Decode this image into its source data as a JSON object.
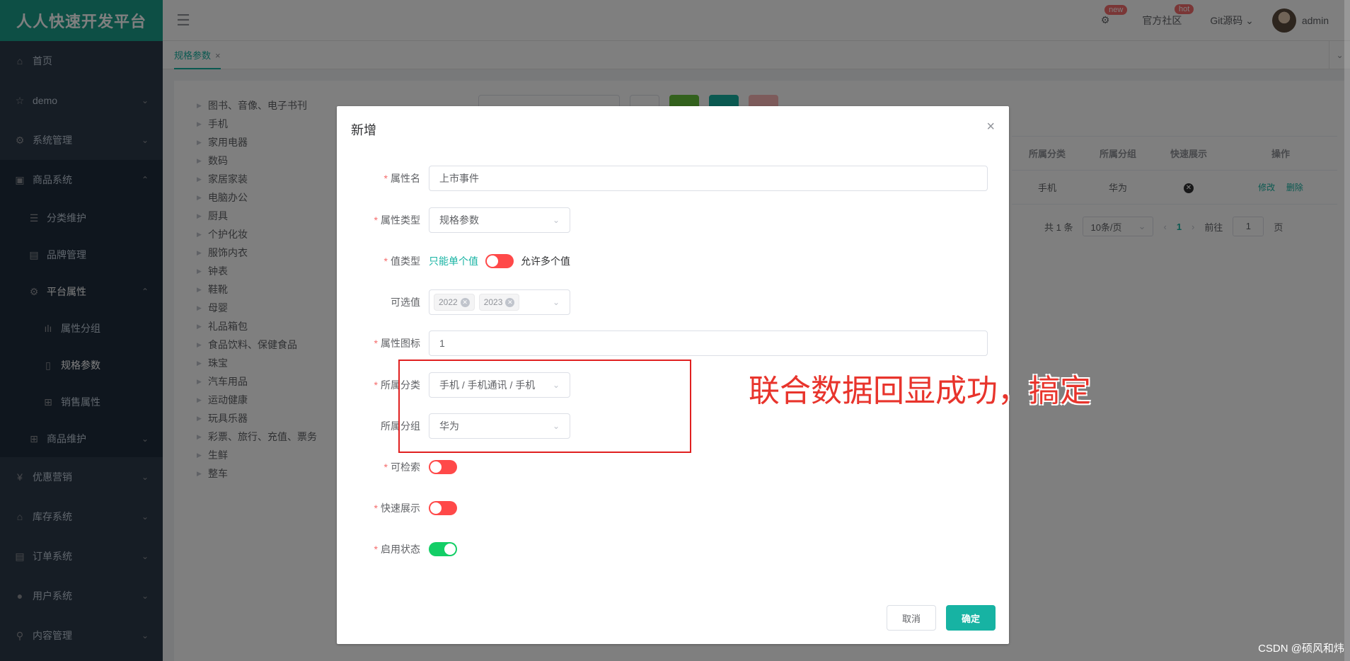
{
  "sidebar": {
    "brand": "人人快速开发平台",
    "items": [
      {
        "label": "首页"
      },
      {
        "label": "demo"
      },
      {
        "label": "系统管理"
      },
      {
        "label": "商品系统"
      }
    ],
    "goods_sub": [
      {
        "label": "分类维护"
      },
      {
        "label": "品牌管理"
      },
      {
        "label": "平台属性"
      }
    ],
    "attr_sub": [
      {
        "label": "属性分组"
      },
      {
        "label": "规格参数"
      },
      {
        "label": "销售属性"
      }
    ],
    "goods_maint": "商品维护",
    "bottom_items": [
      {
        "label": "优惠营销"
      },
      {
        "label": "库存系统"
      },
      {
        "label": "订单系统"
      },
      {
        "label": "用户系统"
      },
      {
        "label": "内容管理"
      }
    ]
  },
  "navbar": {
    "new_badge": "new",
    "community": "官方社区",
    "hot_badge": "hot",
    "git": "Git源码",
    "user": "admin"
  },
  "tabs": [
    {
      "label": "规格参数"
    }
  ],
  "tree": [
    "图书、音像、电子书刊",
    "手机",
    "家用电器",
    "数码",
    "家居家装",
    "电脑办公",
    "厨具",
    "个护化妆",
    "服饰内衣",
    "钟表",
    "鞋靴",
    "母婴",
    "礼品箱包",
    "食品饮料、保健食品",
    "珠宝",
    "汽车用品",
    "运动健康",
    "玩具乐器",
    "彩票、旅行、充值、票务",
    "生鲜",
    "整车"
  ],
  "table": {
    "headers": [
      "所属分类",
      "所属分组",
      "快速展示",
      "操作"
    ],
    "row": {
      "category": "手机",
      "group": "华为",
      "edit": "修改",
      "delete": "删除"
    }
  },
  "pager": {
    "total": "共 1 条",
    "size": "10条/页",
    "current": "1",
    "goto": "前往",
    "goto_value": "1",
    "page": "页"
  },
  "dialog": {
    "title": "新增",
    "fields": {
      "name_label": "属性名",
      "name_value": "上市事件",
      "type_label": "属性类型",
      "type_value": "规格参数",
      "valtype_label": "值类型",
      "valtype_left": "只能单个值",
      "valtype_right": "允许多个值",
      "options_label": "可选值",
      "options": [
        "2022",
        "2023"
      ],
      "icon_label": "属性图标",
      "icon_value": "1",
      "category_label": "所属分类",
      "category_value": "手机 / 手机通讯 / 手机",
      "group_label": "所属分组",
      "group_value": "华为",
      "searchable_label": "可检索",
      "quick_label": "快速展示",
      "enable_label": "启用状态"
    },
    "cancel": "取消",
    "confirm": "确定"
  },
  "annotation": "联合数据回显成功，搞定",
  "watermark": "CSDN @硕风和炜"
}
